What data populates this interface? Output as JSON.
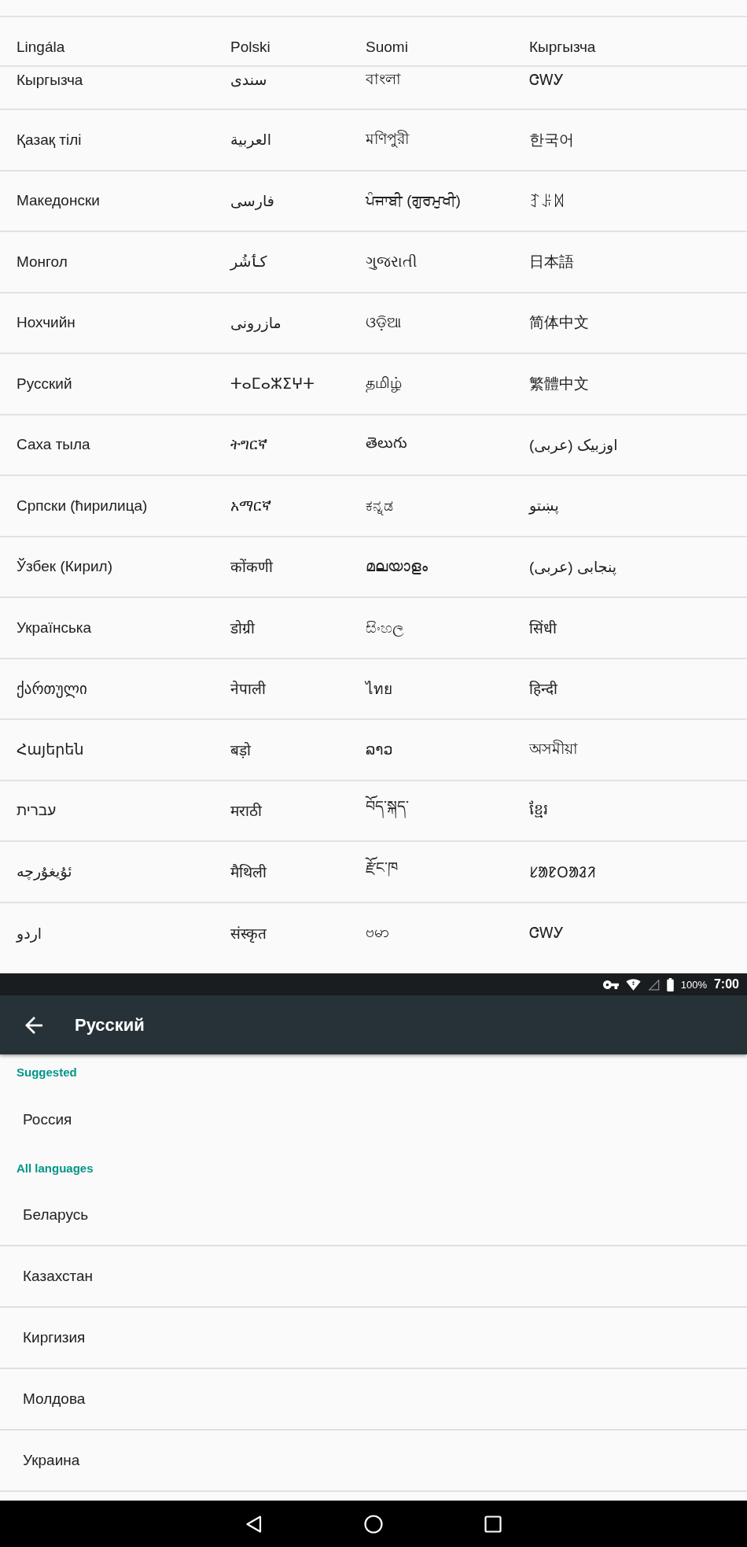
{
  "language_grid": {
    "rows": [
      [
        "Lingála",
        "Polski",
        "Suomi",
        "Кыргызча"
      ],
      [
        "Кыргызча",
        "سندی",
        "বাংলা",
        "ᏣᎳᎩ"
      ],
      [
        "Қазақ тілі",
        "العربية",
        "মণিপুরী",
        "한국어"
      ],
      [
        "Македонски",
        "فارسی",
        "ਪੰਜਾਬੀ (ਗੁਰਮੁਖੀ)",
        "ꆈꌠꉙ"
      ],
      [
        "Монгол",
        "کٲشُر",
        "ગુજરાતી",
        "日本語"
      ],
      [
        "Нохчийн",
        "مازرونی",
        "ଓଡ଼ିଆ",
        "简体中文"
      ],
      [
        "Русский",
        "ⵜⴰⵎⴰⵣⵉⵖⵜ",
        "தமிழ்",
        "繁體中文"
      ],
      [
        "Саха тыла",
        "ትግርኛ",
        "తెలుగు",
        "اوزبیک (عربی)"
      ],
      [
        "Српски (ћирилица)",
        "አማርኛ",
        "ಕನ್ನಡ",
        "پښتو"
      ],
      [
        "Ўзбек (Кирил)",
        "कोंकणी",
        "മലയാളം",
        "پنجابی (عربی)"
      ],
      [
        "Українська",
        "डोग्री",
        "සිංහල",
        "सिंधी"
      ],
      [
        "ქართული",
        "नेपाली",
        "ไทย",
        "हिन्दी"
      ],
      [
        "Հայերեն",
        "बड़ो",
        "ລາວ",
        "অসমীয়া"
      ],
      [
        "עברית",
        "मराठी",
        "བོད་སྐད་",
        "ខ្មែរ"
      ],
      [
        "ئۇيغۇرچە",
        "मैथिली",
        "རྫོང་ཁ",
        "ᱥᱟᱱᱛᱟᱲᱤ"
      ],
      [
        "اردو",
        "संस्कृत",
        "ဗမာ",
        "ᏣᎳᎩ"
      ]
    ]
  },
  "status_bar": {
    "battery": "100%",
    "time": "7:00"
  },
  "app_bar": {
    "title": "Русский"
  },
  "sections": [
    {
      "header": "Suggested",
      "items": [
        "Россия"
      ]
    },
    {
      "header": "All languages",
      "items": [
        "Беларусь",
        "Казахстан",
        "Киргизия",
        "Молдова",
        "Украина"
      ]
    }
  ]
}
